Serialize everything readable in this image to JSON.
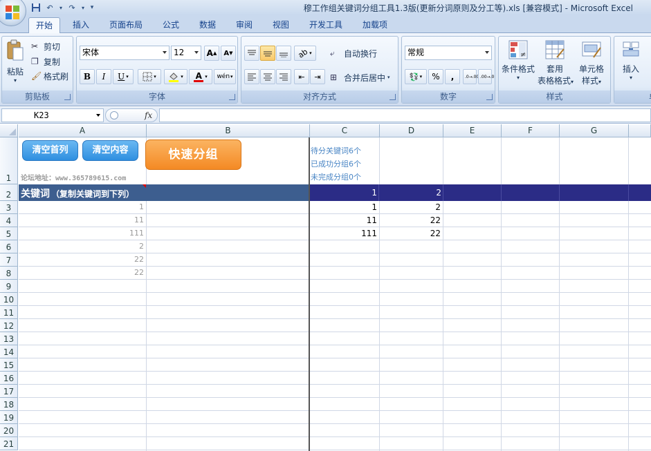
{
  "window": {
    "title": "穆工作组关键词分组工具1.3版(更新分词原则及分工等).xls  [兼容模式] - Microsoft Excel"
  },
  "tabs": [
    "开始",
    "插入",
    "页面布局",
    "公式",
    "数据",
    "审阅",
    "视图",
    "开发工具",
    "加载项"
  ],
  "ribbon": {
    "clipboard": {
      "label": "剪贴板",
      "paste": "粘贴",
      "cut": "剪切",
      "copy": "复制",
      "format_painter": "格式刷"
    },
    "font": {
      "label": "字体",
      "name": "宋体",
      "size": "12",
      "bold": "B",
      "italic": "I",
      "underline": "U",
      "font_color_letter": "A",
      "grow": "A",
      "shrink": "A",
      "phonetic": "wén"
    },
    "alignment": {
      "label": "对齐方式",
      "wrap": "自动换行",
      "merge": "合并后居中"
    },
    "number": {
      "label": "数字",
      "format": "常规",
      "percent": "%",
      "comma": ",",
      "inc_decimal": ".0→.00",
      "dec_decimal": ".00→.0"
    },
    "styles": {
      "label": "样式",
      "conditional": "条件格式",
      "table_line1": "套用",
      "table_line2": "表格格式",
      "cell_line1": "单元格",
      "cell_line2": "样式"
    },
    "cells": {
      "label": "单",
      "insert": "插入"
    }
  },
  "formula_bar": {
    "name_box": "K23",
    "fx": "fx",
    "formula": ""
  },
  "columns": [
    "A",
    "B",
    "C",
    "D",
    "E",
    "F",
    "G"
  ],
  "rows": [
    "1",
    "2",
    "3",
    "4",
    "5",
    "6",
    "7",
    "8",
    "9",
    "10",
    "11",
    "12",
    "13",
    "14",
    "15",
    "16",
    "17",
    "18",
    "19",
    "20",
    "21"
  ],
  "sheet": {
    "buttons": {
      "clear_first_col": "清空首列",
      "clear_content": "清空内容",
      "quick_group": "快速分组"
    },
    "forum": "论坛地址：www.365789615.com",
    "status": {
      "pending": "待分关键词6个",
      "grouped": "已成功分组6个",
      "ungrouped": "未完成分组0个"
    },
    "header_row": {
      "keyword_title": "关键词",
      "keyword_hint": "（复制关键词到下列）",
      "c2": "1",
      "d2": "2"
    },
    "col_a": [
      "1",
      "11",
      "111",
      "2",
      "22",
      "22"
    ],
    "col_c": [
      "1",
      "11",
      "111"
    ],
    "col_d": [
      "2",
      "22",
      "22"
    ]
  },
  "colors": {
    "header_bar": "#3d5e8f",
    "header_bar_right": "#2b2c86",
    "quick_group_btn": "#f79a3a",
    "blue_btn": "#3fa0e8",
    "status_text": "#4a86c5"
  }
}
